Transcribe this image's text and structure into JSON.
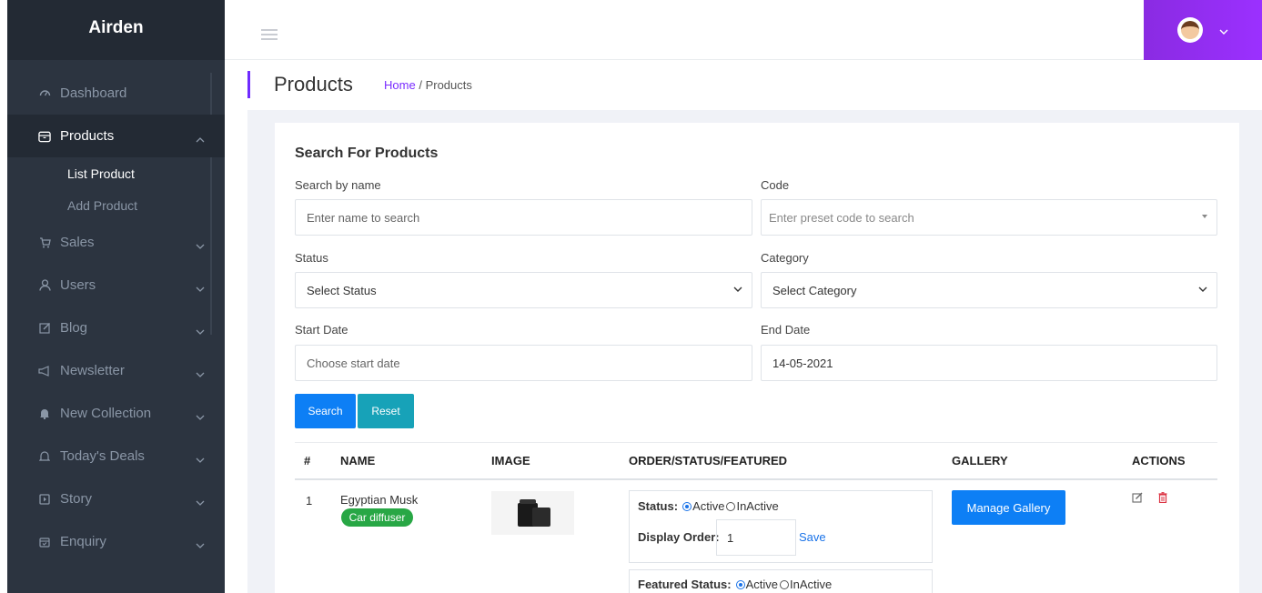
{
  "app": {
    "brand": "Airden"
  },
  "sidebar": {
    "items": [
      {
        "label": "Dashboard",
        "icon": "dashboard-icon"
      },
      {
        "label": "Products",
        "icon": "products-icon"
      },
      {
        "label": "Sales",
        "icon": "cart-icon"
      },
      {
        "label": "Users",
        "icon": "user-icon"
      },
      {
        "label": "Blog",
        "icon": "edit-icon"
      },
      {
        "label": "Newsletter",
        "icon": "megaphone-icon"
      },
      {
        "label": "New Collection",
        "icon": "bell-icon"
      },
      {
        "label": "Today's Deals",
        "icon": "bell-outline-icon"
      },
      {
        "label": "Story",
        "icon": "square-play-icon"
      },
      {
        "label": "Enquiry",
        "icon": "calendar-icon"
      }
    ],
    "sub_items": [
      {
        "label": "List Product"
      },
      {
        "label": "Add Product"
      }
    ]
  },
  "header": {
    "page_title": "Products",
    "breadcrumb_home": "Home",
    "breadcrumb_sep": "/",
    "breadcrumb_current": "Products"
  },
  "search": {
    "title": "Search For Products",
    "name_label": "Search by name",
    "name_placeholder": "Enter name to search",
    "code_label": "Code",
    "code_placeholder": "Enter preset code to search",
    "status_label": "Status",
    "status_value": "Select Status",
    "category_label": "Category",
    "category_value": "Select Category",
    "start_label": "Start Date",
    "start_placeholder": "Choose start date",
    "end_label": "End Date",
    "end_value": "14-05-2021",
    "search_button": "Search",
    "reset_button": "Reset"
  },
  "table": {
    "headers": [
      "#",
      "NAME",
      "IMAGE",
      "ORDER/STATUS/FEATURED",
      "GALLERY",
      "ACTIONS"
    ],
    "rows": [
      {
        "index": "1",
        "name": "Egyptian Musk",
        "category": "Car diffuser",
        "status_label": "Status:",
        "active_label": "Active",
        "inactive_label": "InActive",
        "order_label": "Display Order:",
        "order_value": "1",
        "save_label": "Save",
        "featured_label": "Featured Status:",
        "gallery_button": "Manage Gallery"
      }
    ]
  },
  "colors": {
    "sidebar_bg": "#2c3440",
    "accent_purple": "#8a2be2",
    "primary_blue": "#0d7ff5",
    "teal": "#17a2b8",
    "badge_green": "#28a745",
    "delete_red": "#dc3545"
  }
}
